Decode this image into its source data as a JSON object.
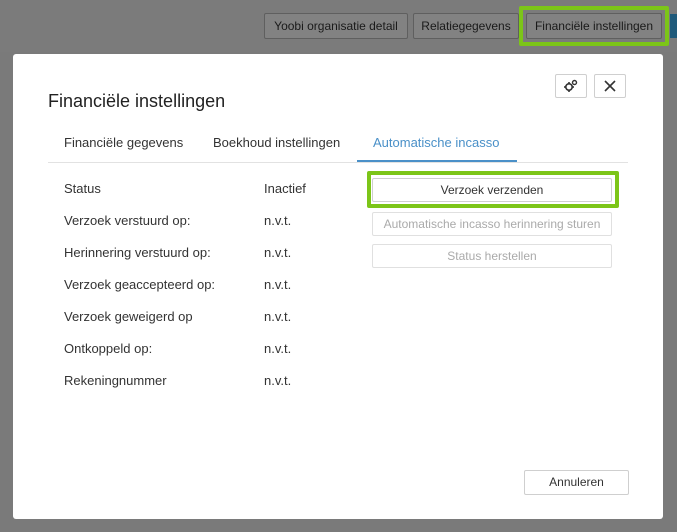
{
  "topbar": {
    "buttons": [
      {
        "label": "Yoobi organisatie detail"
      },
      {
        "label": "Relatiegegevens"
      },
      {
        "label": "Financiële instellingen"
      }
    ],
    "highlight_color": "#7cc518"
  },
  "modal": {
    "title": "Financiële instellingen",
    "icons": {
      "settings": "gears-icon",
      "close": "close-icon"
    },
    "tabs": [
      {
        "label": "Financiële gegevens",
        "active": false
      },
      {
        "label": "Boekhoud instellingen",
        "active": false
      },
      {
        "label": "Automatische incasso",
        "active": true
      }
    ],
    "rows": [
      {
        "label": "Status",
        "value": "Inactief"
      },
      {
        "label": "Verzoek verstuurd op:",
        "value": "n.v.t."
      },
      {
        "label": "Herinnering verstuurd op:",
        "value": "n.v.t."
      },
      {
        "label": "Verzoek geaccepteerd op:",
        "value": "n.v.t."
      },
      {
        "label": "Verzoek geweigerd op",
        "value": "n.v.t."
      },
      {
        "label": "Ontkoppeld op:",
        "value": "n.v.t."
      },
      {
        "label": "Rekeningnummer",
        "value": "n.v.t."
      }
    ],
    "actions": {
      "send_request": "Verzoek verzenden",
      "send_reminder": "Automatische incasso herinnering sturen",
      "restore_status": "Status herstellen"
    },
    "cancel_label": "Annuleren",
    "accent_color": "#4a90c8"
  }
}
